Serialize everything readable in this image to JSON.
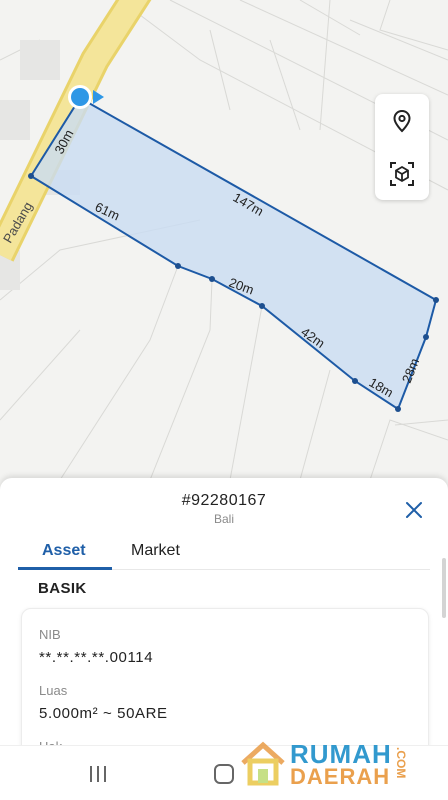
{
  "map": {
    "street_label": "Padang",
    "dimensions": [
      "30m",
      "147m",
      "61m",
      "20m",
      "42m",
      "18m",
      "28m"
    ],
    "tools": [
      {
        "icon": "location-pin-icon"
      },
      {
        "icon": "3d-view-icon"
      }
    ],
    "colors": {
      "parcel_fill": "#c9dcf2",
      "parcel_stroke": "#1d5aa6",
      "road": "#f2e08a",
      "marker": "#2e97e6"
    }
  },
  "sheet": {
    "title": "#92280167",
    "subtitle": "Bali",
    "close_icon": "close-icon",
    "tabs": [
      {
        "label": "Asset",
        "active": true
      },
      {
        "label": "Market",
        "active": false
      }
    ],
    "section_title": "BASIK",
    "fields": [
      {
        "label": "NIB",
        "value": "**.**.**.**.00114"
      },
      {
        "label": "Luas",
        "value": "5.000m² ~ 50ARE"
      },
      {
        "label": "Hak",
        "value": ""
      }
    ]
  },
  "navbar": {
    "buttons": [
      {
        "icon": "recent-apps-icon"
      },
      {
        "icon": "home-icon"
      }
    ]
  },
  "watermark": {
    "line1": "RUMAH",
    "line2": "DAERAH",
    "suffix": ".COM"
  }
}
